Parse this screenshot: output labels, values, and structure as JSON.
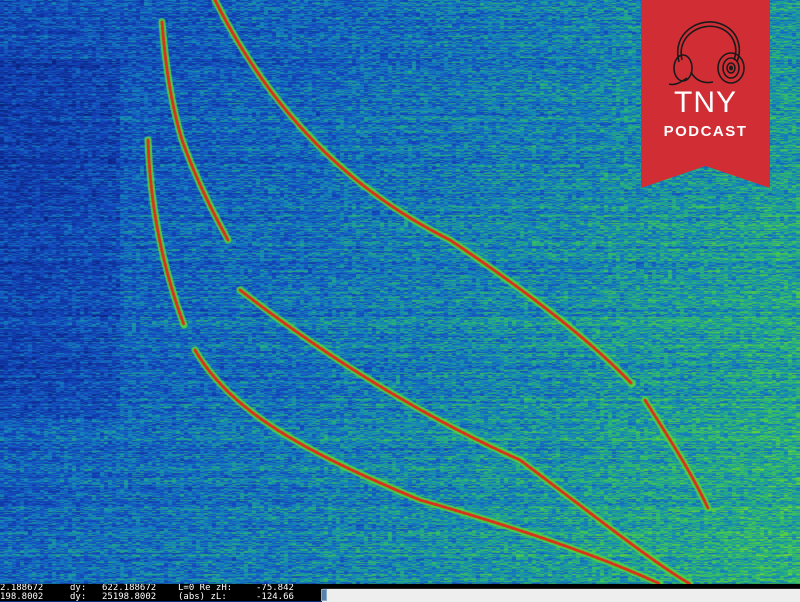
{
  "badge": {
    "title": "TNY",
    "subtitle": "PODCAST",
    "color": "#d12d35",
    "icon": "headphones-icon"
  },
  "readout": {
    "row1": {
      "x": "2.188672",
      "dy_label": "dy:",
      "dy": "622.188672",
      "mode": "L=0 Re zH:",
      "value": "-75.842"
    },
    "row2": {
      "x": "198.8002",
      "dy_label": "dy:",
      "dy": "25198.8002",
      "mode": "(abs) zL:",
      "value": "-124.66"
    }
  },
  "colors": {
    "background_low": "#0d2a7a",
    "background_high": "#3fbf5a",
    "trace": "#e8201a"
  }
}
